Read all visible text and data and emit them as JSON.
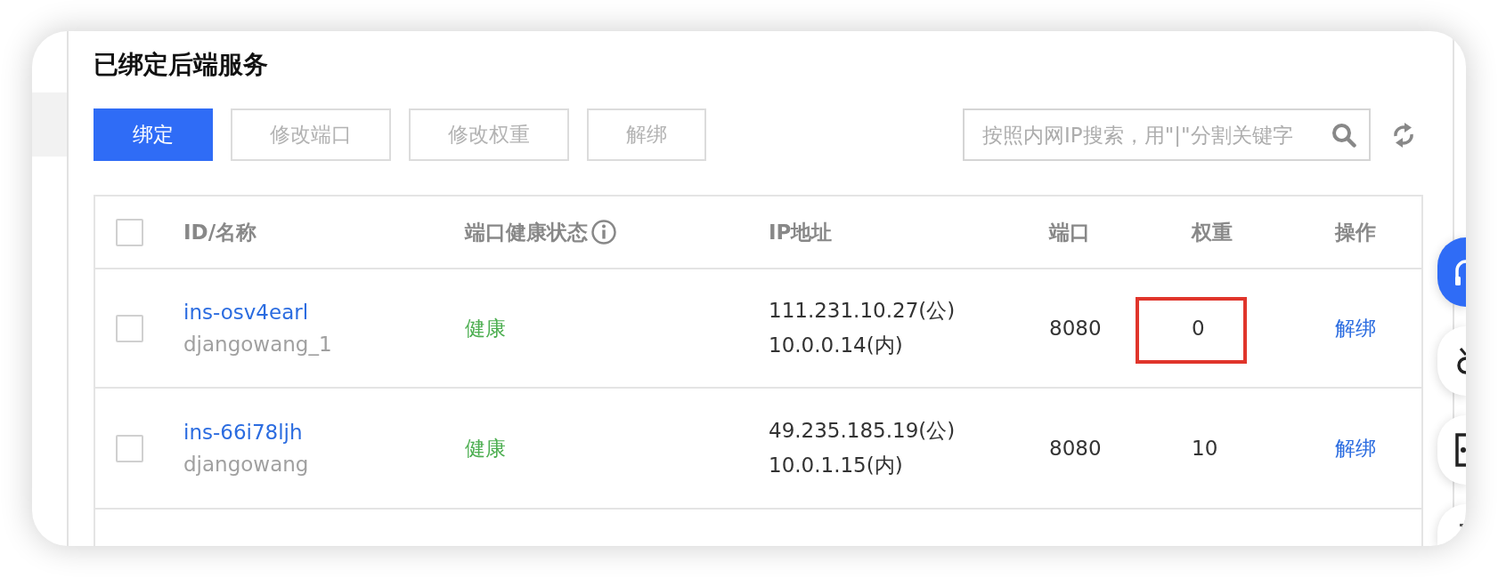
{
  "section": {
    "title": "已绑定后端服务"
  },
  "toolbar": {
    "buttons": [
      {
        "label": "绑定",
        "kind": "primary",
        "disabled": false
      },
      {
        "label": "修改端口",
        "kind": "default",
        "disabled": true
      },
      {
        "label": "修改权重",
        "kind": "default",
        "disabled": true
      },
      {
        "label": "解绑",
        "kind": "default",
        "disabled": true
      }
    ],
    "search": {
      "placeholder": "按照内网IP搜索，用\"|\"分割关键字"
    }
  },
  "table": {
    "select_all": {
      "checked": false
    },
    "columns": [
      {
        "label": "ID/名称",
        "info_icon": false
      },
      {
        "label": "端口健康状态",
        "info_icon": true
      },
      {
        "label": "IP地址",
        "info_icon": false
      },
      {
        "label": "端口",
        "info_icon": false
      },
      {
        "label": "权重",
        "info_icon": false
      },
      {
        "label": "操作",
        "info_icon": false
      }
    ],
    "rows": [
      {
        "checked": false,
        "id": "ins-osv4earl",
        "name": "djangowang_1",
        "health": "健康",
        "public_ip": "111.231.10.27(公)",
        "private_ip": "10.0.0.14(内)",
        "port": "8080",
        "weight": "0",
        "highlighted": true,
        "action": "解绑"
      },
      {
        "checked": false,
        "id": "ins-66i78ljh",
        "name": "djangowang",
        "health": "健康",
        "public_ip": "49.235.185.19(公)",
        "private_ip": "10.0.1.15(内)",
        "port": "8080",
        "weight": "10",
        "highlighted": false,
        "action": "解绑"
      }
    ]
  },
  "float_buttons": [
    {
      "kind": "arc",
      "active": true
    },
    {
      "kind": "ring",
      "active": false
    },
    {
      "kind": "frame",
      "active": false
    },
    {
      "kind": "dot",
      "active": false
    }
  ]
}
